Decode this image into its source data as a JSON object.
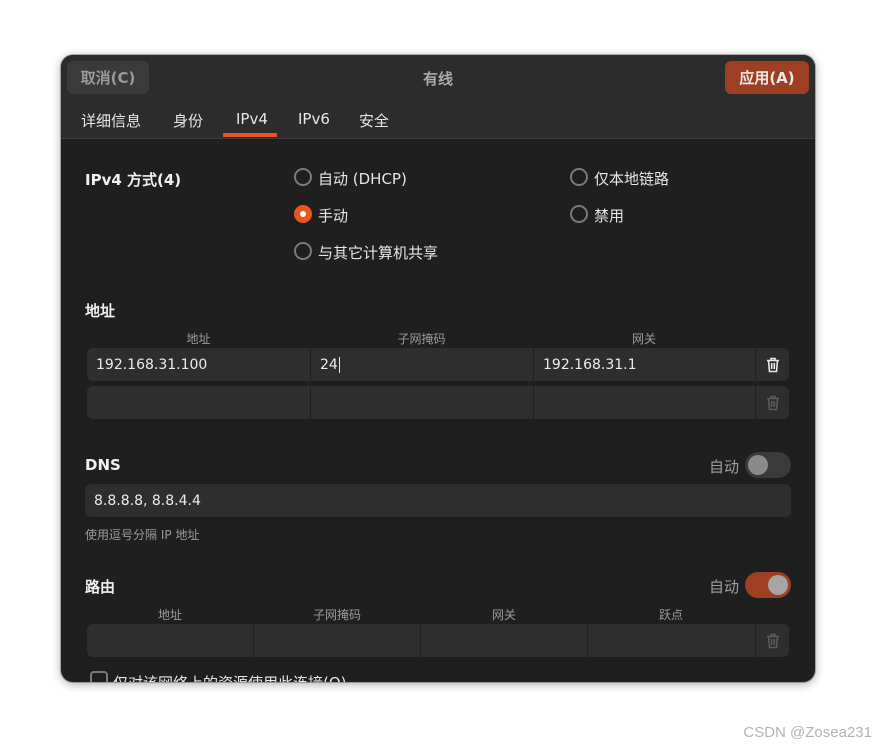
{
  "window": {
    "title": "有线"
  },
  "buttons": {
    "cancel": "取消(C)",
    "apply": "应用(A)"
  },
  "tabs": [
    {
      "label": "详细信息",
      "active": false
    },
    {
      "label": "身份",
      "active": false
    },
    {
      "label": "IPv4",
      "active": true
    },
    {
      "label": "IPv6",
      "active": false
    },
    {
      "label": "安全",
      "active": false
    }
  ],
  "ipv4_method": {
    "label": "IPv4 方式(4)",
    "options": [
      {
        "label": "自动 (DHCP)",
        "checked": false
      },
      {
        "label": "仅本地链路",
        "checked": false
      },
      {
        "label": "手动",
        "checked": true
      },
      {
        "label": "禁用",
        "checked": false
      },
      {
        "label": "与其它计算机共享",
        "checked": false
      }
    ]
  },
  "addresses": {
    "label": "地址",
    "columns": [
      "地址",
      "子网掩码",
      "网关"
    ],
    "rows": [
      {
        "address": "192.168.31.100",
        "netmask": "24",
        "gateway": "192.168.31.1"
      },
      {
        "address": "",
        "netmask": "",
        "gateway": ""
      }
    ]
  },
  "dns": {
    "label": "DNS",
    "auto_label": "自动",
    "auto_on": false,
    "value": "8.8.8.8, 8.8.4.4",
    "hint": "使用逗号分隔 IP 地址"
  },
  "routes": {
    "label": "路由",
    "auto_label": "自动",
    "auto_on": true,
    "columns": [
      "地址",
      "子网掩码",
      "网关",
      "跃点"
    ],
    "rows": [
      {
        "address": "",
        "netmask": "",
        "gateway": "",
        "metric": ""
      }
    ]
  },
  "only_resources": {
    "label": "仅对该网络上的资源使用此连接(O)",
    "checked": false
  },
  "watermark": "CSDN @Zosea231",
  "colors": {
    "accent": "#e95420",
    "apply_bg": "#9c3f22",
    "dialog_bg": "#1f1f1f",
    "header_bg": "#2c2c2c",
    "field_bg": "#2e2e2e"
  },
  "icons": {
    "row_delete": "trash-icon"
  }
}
